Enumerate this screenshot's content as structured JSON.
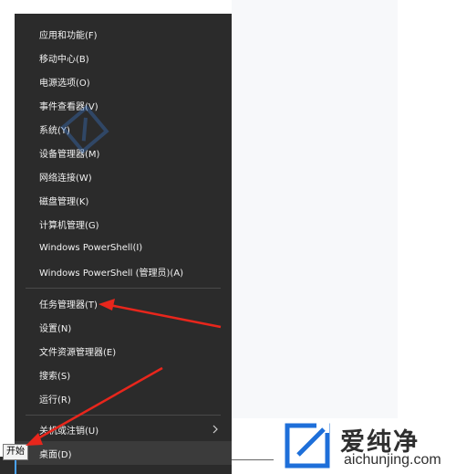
{
  "menu": {
    "items": [
      {
        "id": "apps-features",
        "label": "应用和功能(F)"
      },
      {
        "id": "mobility-center",
        "label": "移动中心(B)"
      },
      {
        "id": "power-options",
        "label": "电源选项(O)"
      },
      {
        "id": "event-viewer",
        "label": "事件查看器(V)"
      },
      {
        "id": "system",
        "label": "系统(Y)"
      },
      {
        "id": "device-manager",
        "label": "设备管理器(M)"
      },
      {
        "id": "network-connections",
        "label": "网络连接(W)"
      },
      {
        "id": "disk-management",
        "label": "磁盘管理(K)"
      },
      {
        "id": "computer-management",
        "label": "计算机管理(G)"
      },
      {
        "id": "powershell",
        "label": "Windows PowerShell(I)"
      },
      {
        "id": "powershell-admin",
        "label": "Windows PowerShell (管理员)(A)"
      },
      {
        "id": "task-manager",
        "label": "任务管理器(T)"
      },
      {
        "id": "settings",
        "label": "设置(N)"
      },
      {
        "id": "file-explorer",
        "label": "文件资源管理器(E)"
      },
      {
        "id": "search",
        "label": "搜索(S)"
      },
      {
        "id": "run",
        "label": "运行(R)"
      },
      {
        "id": "shutdown-signout",
        "label": "关机或注销(U)"
      },
      {
        "id": "desktop",
        "label": "桌面(D)"
      }
    ]
  },
  "tooltip": {
    "start_label": "开始"
  },
  "logo": {
    "brand": "爱纯净",
    "site": "aichunjing.com"
  },
  "colors": {
    "menu_bg": "#2b2b2b",
    "menu_text": "#f2f2f2",
    "highlight_bg": "#3b3b3b",
    "arrow_red": "#e8261c",
    "logo_blue": "#1e6fd9"
  }
}
